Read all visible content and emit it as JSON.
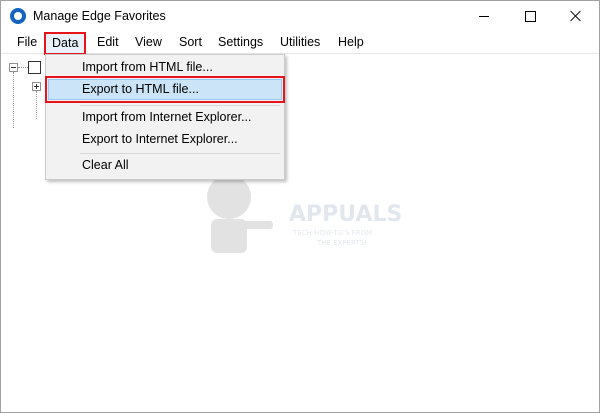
{
  "window": {
    "title": "Manage Edge Favorites"
  },
  "menubar": {
    "items": [
      "File",
      "Data",
      "Edit",
      "View",
      "Sort",
      "Settings",
      "Utilities",
      "Help"
    ],
    "active": "Data"
  },
  "data_menu": {
    "items": [
      {
        "label": "Import from HTML file..."
      },
      {
        "label": "Export to HTML file...",
        "highlighted": true
      },
      {
        "label": "Import from Internet Explorer..."
      },
      {
        "label": "Export to Internet Explorer..."
      },
      {
        "label": "Clear All"
      }
    ]
  },
  "watermark": {
    "brand": "APPUALS",
    "tagline_line1": "TECH HOW-TO'S FROM",
    "tagline_line2": "THE EXPERTS!"
  },
  "colors": {
    "highlight_outline": "#e8141b",
    "menu_hover_fill": "#cce4f7",
    "app_icon": "#1565c0"
  },
  "icons": [
    "app-edge-icon",
    "minimize-icon",
    "maximize-icon",
    "close-icon",
    "tree-collapse-icon",
    "tree-expand-icon"
  ]
}
